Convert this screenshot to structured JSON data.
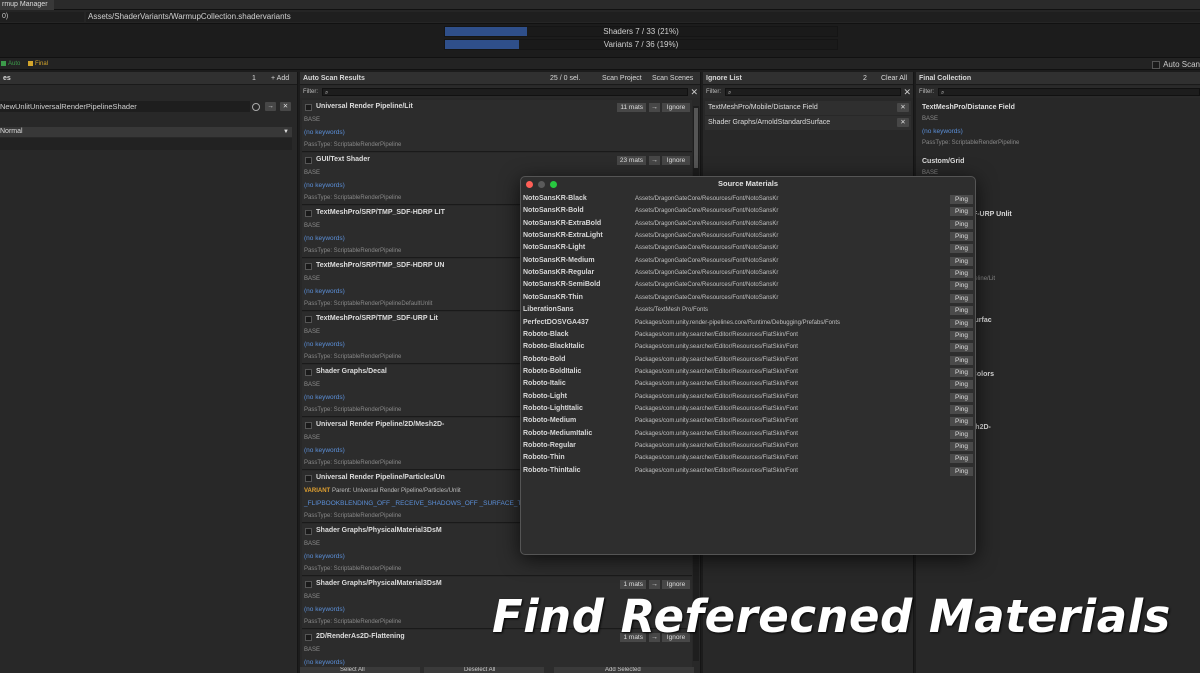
{
  "window": {
    "title": "rmup Manager",
    "count": "0)",
    "path": "Assets/ShaderVariants/WarmupCollection.shadervariants"
  },
  "progress": {
    "shaders": {
      "label": "Shaders   7 / 33  (21%)",
      "fraction": 0.21
    },
    "variants": {
      "label": "Variants  7 / 36  (19%)",
      "fraction": 0.19
    }
  },
  "legend": {
    "auto": "Auto",
    "final": "Final",
    "auto_scan": "Auto Scan"
  },
  "colors": {
    "auto": "#3c9a4a",
    "final": "#d3a52c",
    "keywords": "#5b8fd8",
    "variant": "#e0a030",
    "progress": "#2f4f8a"
  },
  "left_panel": {
    "header": "es",
    "count": "1",
    "add": "+ Add",
    "item": "NewUnlitUniversalRenderPipelineShader",
    "mode": "Normal"
  },
  "scan_panel": {
    "header": "Auto Scan Results",
    "sel": "25 / 0 sel.",
    "scan_project": "Scan Project",
    "scan_scenes": "Scan Scenes",
    "filter_label": "Filter:",
    "ignore_label": "Ignore",
    "cards": [
      {
        "name": "Universal Render Pipeline/Lit",
        "mats": "11 mats",
        "base": "BASE",
        "kw": "(no keywords)",
        "pt": "PassType: ScriptableRenderPipeline"
      },
      {
        "name": "GUI/Text Shader",
        "mats": "23 mats",
        "base": "BASE",
        "kw": "(no keywords)",
        "pt": "PassType: ScriptableRenderPipeline"
      },
      {
        "name": "TextMeshPro/SRP/TMP_SDF-HDRP LIT",
        "mats": "",
        "base": "BASE",
        "kw": "(no keywords)",
        "pt": "PassType: ScriptableRenderPipeline"
      },
      {
        "name": "TextMeshPro/SRP/TMP_SDF-HDRP UN",
        "mats": "",
        "base": "BASE",
        "kw": "(no keywords)",
        "pt": "PassType: ScriptableRenderPipelineDefaultUnlit"
      },
      {
        "name": "TextMeshPro/SRP/TMP_SDF-URP Lit",
        "mats": "",
        "base": "BASE",
        "kw": "(no keywords)",
        "pt": "PassType: ScriptableRenderPipeline"
      },
      {
        "name": "Shader Graphs/Decal",
        "mats": "",
        "base": "BASE",
        "kw": "(no keywords)",
        "pt": "PassType: ScriptableRenderPipeline"
      },
      {
        "name": "Universal Render Pipeline/2D/Mesh2D-",
        "mats": "",
        "base": "BASE",
        "kw": "(no keywords)",
        "pt": "PassType: ScriptableRenderPipeline"
      },
      {
        "name": "Universal Render Pipeline/Particles/Un",
        "mats": "",
        "base": "VARIANT",
        "parent": "Parent: Universal Render Pipeline/Particles/Unlit",
        "kw": "_FLIPBOOKBLENDING_OFF _RECEIVE_SHADOWS_OFF _SURFACE_TYPE_T",
        "pt": "PassType: ScriptableRenderPipeline"
      },
      {
        "name": "Shader Graphs/PhysicalMaterial3DsM",
        "mats": "",
        "base": "BASE",
        "kw": "(no keywords)",
        "pt": "PassType: ScriptableRenderPipeline"
      },
      {
        "name": "Shader Graphs/PhysicalMaterial3DsM",
        "mats": "1 mats",
        "base": "BASE",
        "kw": "(no keywords)",
        "pt": "PassType: ScriptableRenderPipeline"
      },
      {
        "name": "2D/RenderAs2D-Flattening",
        "mats": "1 mats",
        "base": "BASE",
        "kw": "(no keywords)",
        "pt": ""
      }
    ],
    "bottom": [
      "Select All",
      "Deselect All",
      "Add Selected"
    ]
  },
  "ignore_panel": {
    "header": "Ignore List",
    "count": "2",
    "clear": "Clear All",
    "filter_label": "Filter:",
    "items": [
      "TextMeshPro/Mobile/Distance Field",
      "Shader Graphs/ArnoldStandardSurface"
    ]
  },
  "final_panel": {
    "header": "Final Collection",
    "filter_label": "Filter:",
    "cards": [
      {
        "name": "TextMeshPro/Distance Field",
        "base": "BASE",
        "kw": "(no keywords)",
        "pt": "PassType: ScriptableRenderPipeline"
      },
      {
        "name": "Custom/Grid",
        "base": "BASE",
        "kw": "",
        "pt": "enderPipeline"
      },
      {
        "name": "o/SRP/TMP_SDF-URP Unlit",
        "base": "",
        "kw": "",
        "pt": "enderPipeline"
      },
      {
        "name": "Pipeline/Lit",
        "base": "niversal Render Pipeline/Lit",
        "kw": "",
        "pt": "enderPipeline"
      },
      {
        "name": "rnoldStandardSurfac",
        "base": "",
        "kw": "",
        "pt": "enderPipeline"
      },
      {
        "name": "ullscreenInvertColors",
        "base": "",
        "kw": "",
        "pt": "enderPipeline"
      },
      {
        "name": "Pipeline/2D/Mesh2D-",
        "base": "",
        "kw": "",
        "pt": "enderPipeline"
      }
    ]
  },
  "modal": {
    "title": "Source Materials",
    "ping": "Ping",
    "rows": [
      {
        "name": "NotoSansKR-Black",
        "path": "Assets/DragonGateCore/Resources/Font/NotoSansKr"
      },
      {
        "name": "NotoSansKR-Bold",
        "path": "Assets/DragonGateCore/Resources/Font/NotoSansKr"
      },
      {
        "name": "NotoSansKR-ExtraBold",
        "path": "Assets/DragonGateCore/Resources/Font/NotoSansKr"
      },
      {
        "name": "NotoSansKR-ExtraLight",
        "path": "Assets/DragonGateCore/Resources/Font/NotoSansKr"
      },
      {
        "name": "NotoSansKR-Light",
        "path": "Assets/DragonGateCore/Resources/Font/NotoSansKr"
      },
      {
        "name": "NotoSansKR-Medium",
        "path": "Assets/DragonGateCore/Resources/Font/NotoSansKr"
      },
      {
        "name": "NotoSansKR-Regular",
        "path": "Assets/DragonGateCore/Resources/Font/NotoSansKr"
      },
      {
        "name": "NotoSansKR-SemiBold",
        "path": "Assets/DragonGateCore/Resources/Font/NotoSansKr"
      },
      {
        "name": "NotoSansKR-Thin",
        "path": "Assets/DragonGateCore/Resources/Font/NotoSansKr"
      },
      {
        "name": "LiberationSans",
        "path": "Assets/TextMesh Pro/Fonts"
      },
      {
        "name": "PerfectDOSVGA437",
        "path": "Packages/com.unity.render-pipelines.core/Runtime/Debugging/Prefabs/Fonts"
      },
      {
        "name": "Roboto-Black",
        "path": "Packages/com.unity.searcher/Editor/Resources/FlatSkin/Font"
      },
      {
        "name": "Roboto-BlackItalic",
        "path": "Packages/com.unity.searcher/Editor/Resources/FlatSkin/Font"
      },
      {
        "name": "Roboto-Bold",
        "path": "Packages/com.unity.searcher/Editor/Resources/FlatSkin/Font"
      },
      {
        "name": "Roboto-BoldItalic",
        "path": "Packages/com.unity.searcher/Editor/Resources/FlatSkin/Font"
      },
      {
        "name": "Roboto-Italic",
        "path": "Packages/com.unity.searcher/Editor/Resources/FlatSkin/Font"
      },
      {
        "name": "Roboto-Light",
        "path": "Packages/com.unity.searcher/Editor/Resources/FlatSkin/Font"
      },
      {
        "name": "Roboto-LightItalic",
        "path": "Packages/com.unity.searcher/Editor/Resources/FlatSkin/Font"
      },
      {
        "name": "Roboto-Medium",
        "path": "Packages/com.unity.searcher/Editor/Resources/FlatSkin/Font"
      },
      {
        "name": "Roboto-MediumItalic",
        "path": "Packages/com.unity.searcher/Editor/Resources/FlatSkin/Font"
      },
      {
        "name": "Roboto-Regular",
        "path": "Packages/com.unity.searcher/Editor/Resources/FlatSkin/Font"
      },
      {
        "name": "Roboto-Thin",
        "path": "Packages/com.unity.searcher/Editor/Resources/FlatSkin/Font"
      },
      {
        "name": "Roboto-ThinItalic",
        "path": "Packages/com.unity.searcher/Editor/Resources/FlatSkin/Font"
      }
    ]
  },
  "overlay_caption": "Find Referecned Materials"
}
